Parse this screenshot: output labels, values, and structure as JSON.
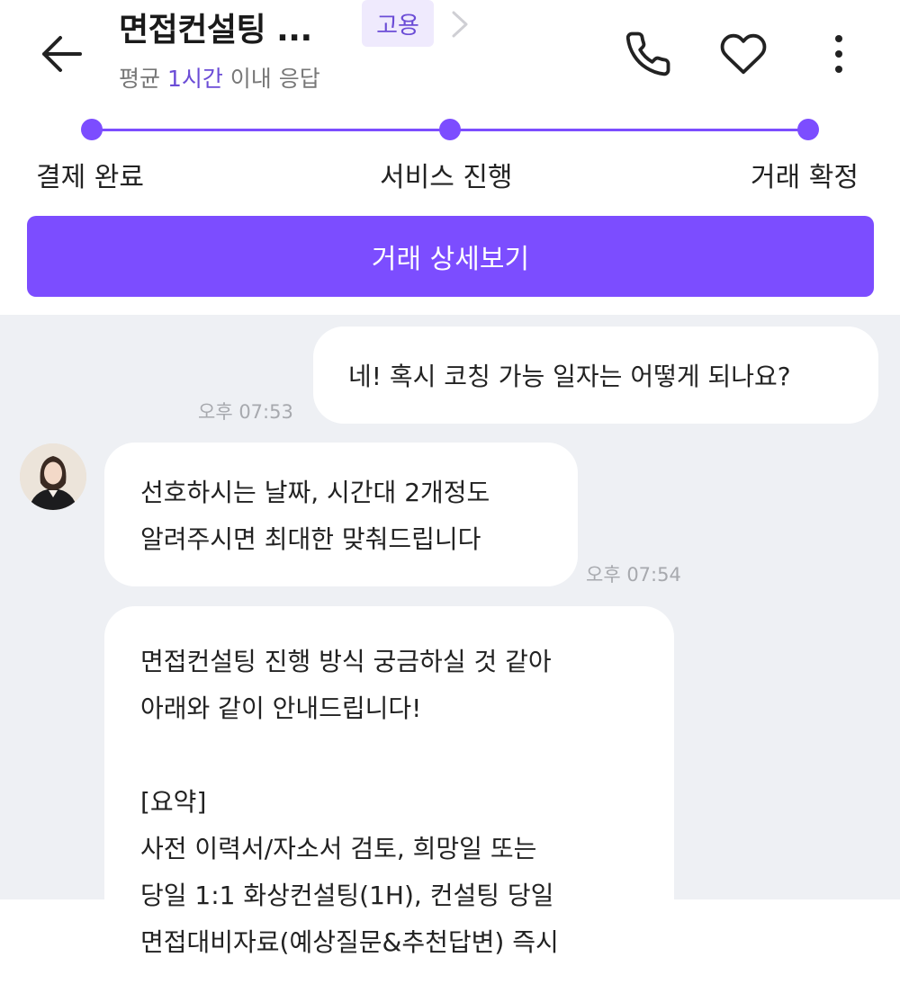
{
  "header": {
    "title": "면접컨설팅 ...",
    "badge": "고용",
    "response_prefix": "평균 ",
    "response_highlight": "1시간",
    "response_suffix": " 이내 응답",
    "icons": {
      "back": "arrow-left-icon",
      "chevron": "chevron-right-icon",
      "call": "phone-icon",
      "favorite": "heart-icon",
      "more": "more-vertical-icon"
    }
  },
  "progress": {
    "steps": [
      "결제 완료",
      "서비스 진행",
      "거래 확정"
    ],
    "accent_color": "#7c4dff"
  },
  "detail_button": {
    "label": "거래 상세보기"
  },
  "messages": [
    {
      "sender": "me",
      "text": "네! 혹시 코칭 가능 일자는 어떻게 되나요?",
      "time": "오후 07:53"
    },
    {
      "sender": "seller",
      "lines": [
        "선호하시는 날짜, 시간대 2개정도",
        "알려주시면 최대한 맞춰드립니다"
      ],
      "time": "오후 07:54"
    },
    {
      "sender": "seller",
      "lines": [
        "면접컨설팅 진행 방식 궁금하실 것 같아",
        "아래와 같이 안내드립니다!",
        "",
        "[요약]",
        "사전 이력서/자소서 검토, 희망일 또는",
        "당일 1:1 화상컨설팅(1H), 컨설팅 당일",
        "면접대비자료(예상질문&추천답변) 즉시"
      ]
    }
  ]
}
